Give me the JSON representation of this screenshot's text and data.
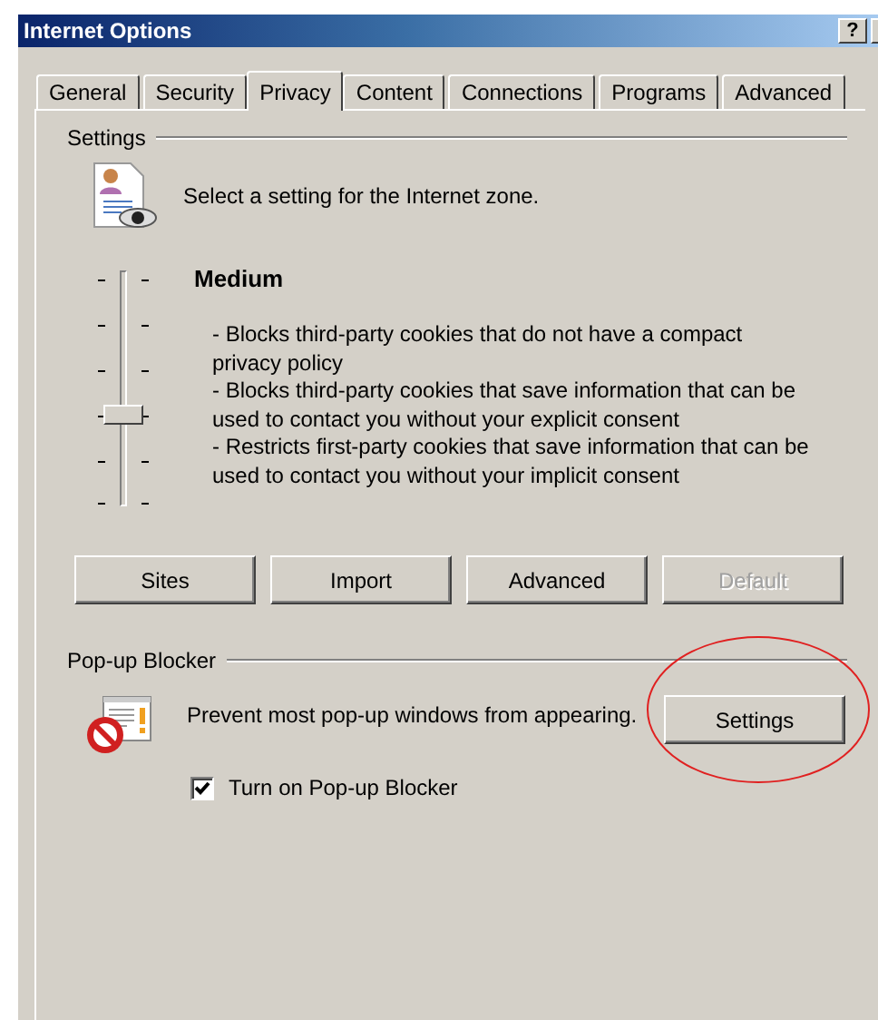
{
  "window": {
    "title": "Internet Options",
    "help_button": "?"
  },
  "tabs": [
    {
      "label": "General",
      "selected": false
    },
    {
      "label": "Security",
      "selected": false
    },
    {
      "label": "Privacy",
      "selected": true
    },
    {
      "label": "Content",
      "selected": false
    },
    {
      "label": "Connections",
      "selected": false
    },
    {
      "label": "Programs",
      "selected": false
    },
    {
      "label": "Advanced",
      "selected": false
    }
  ],
  "settings": {
    "heading": "Settings",
    "zone_text": "Select a setting for the Internet zone.",
    "slider": {
      "level": 0.4
    },
    "level_name": "Medium",
    "description": [
      "- Blocks third-party cookies that do not have a compact privacy policy",
      "- Blocks third-party cookies that save information that can be used to contact you without your explicit consent",
      "- Restricts first-party cookies that save information that can be used to contact you without your implicit consent"
    ],
    "buttons": [
      {
        "label": "Sites",
        "disabled": false
      },
      {
        "label": "Import",
        "disabled": false
      },
      {
        "label": "Advanced",
        "disabled": false
      },
      {
        "label": "Default",
        "disabled": true
      }
    ]
  },
  "popup_blocker": {
    "heading": "Pop-up Blocker",
    "text": "Prevent most pop-up windows from appearing.",
    "settings_button": "Settings",
    "checkbox": {
      "label": "Turn on Pop-up Blocker",
      "checked": true
    }
  }
}
